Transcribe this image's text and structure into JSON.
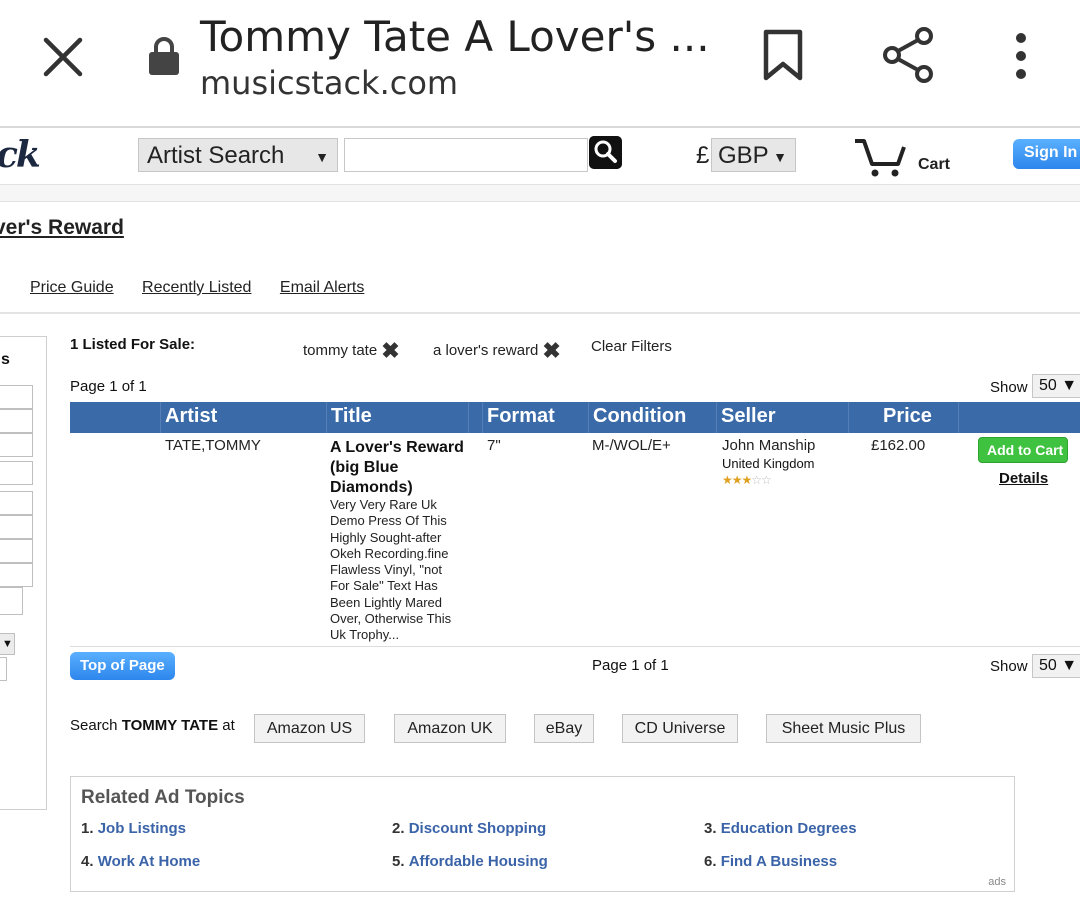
{
  "browser": {
    "title": "Tommy Tate A Lover's ...",
    "url": "musicstack.com"
  },
  "header": {
    "logo_text": "ck",
    "search_type": "Artist Search",
    "search_value": "",
    "currency_symbol": "£",
    "currency": "GBP",
    "cart_label": "Cart",
    "signin_label": "Sign In"
  },
  "page": {
    "heading": "ver's Reward",
    "subnav": [
      "Price Guide",
      "Recently Listed",
      "Email Alerts"
    ]
  },
  "sidebar": {
    "letter": "s"
  },
  "filters": {
    "listed_label": "1 Listed For Sale:",
    "chips": [
      "tommy tate",
      "a lover's reward"
    ],
    "clear_label": "Clear Filters"
  },
  "pagination": {
    "page_text": "Page 1 of 1",
    "show_label": "Show",
    "show_value": "50"
  },
  "table": {
    "headers": [
      "Artist",
      "Title",
      "Format",
      "Condition",
      "Seller",
      "Price"
    ],
    "rows": [
      {
        "artist": "TATE,TOMMY",
        "title": "A Lover's Reward (big Blue Diamonds)",
        "description": "Very Very Rare Uk Demo Press Of This Highly Sought-after Okeh Recording.fine Flawless Vinyl, \"not For Sale\" Text Has Been Lightly Mared Over, Otherwise This Uk Trophy...",
        "format": "7\"",
        "condition": "M-/WOL/E+",
        "seller": "John Manship",
        "seller_location": "United Kingdom",
        "rating_stars": 3,
        "price": "£162.00",
        "add_to_cart": "Add to Cart",
        "details": "Details"
      }
    ]
  },
  "bottom": {
    "top_of_page": "Top of Page"
  },
  "search_at": {
    "prefix": "Search",
    "artist": "TOMMY TATE",
    "suffix": "at",
    "sites": [
      "Amazon US",
      "Amazon UK",
      "eBay",
      "CD Universe",
      "Sheet Music Plus"
    ]
  },
  "ads": {
    "heading": "Related Ad Topics",
    "items": [
      {
        "num": "1.",
        "label": "Job Listings"
      },
      {
        "num": "2.",
        "label": "Discount Shopping"
      },
      {
        "num": "3.",
        "label": "Education Degrees"
      },
      {
        "num": "4.",
        "label": "Work At Home"
      },
      {
        "num": "5.",
        "label": "Affordable Housing"
      },
      {
        "num": "6.",
        "label": "Find A Business"
      }
    ],
    "footer": "ads"
  },
  "colors": {
    "table_header": "#3a6aa8",
    "add_to_cart": "#3fc23f",
    "button_blue": "#2d86ec",
    "ad_link": "#3a63a8"
  }
}
